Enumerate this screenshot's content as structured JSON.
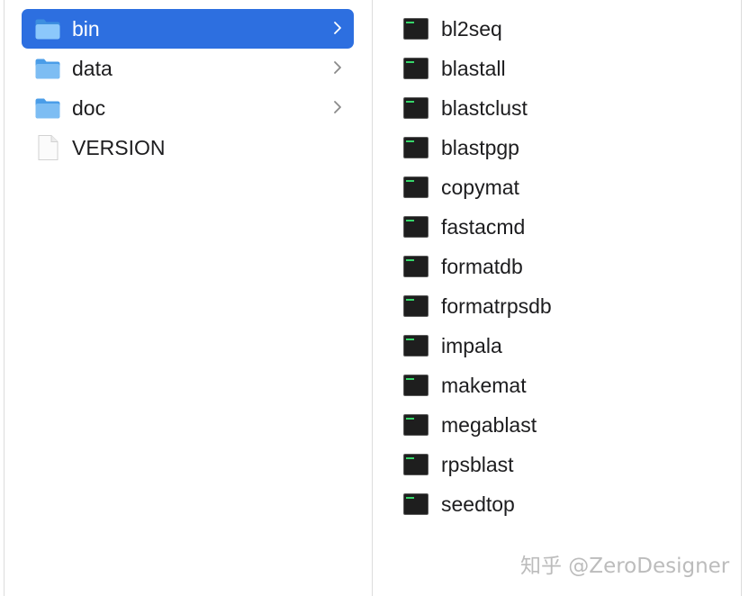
{
  "left_column": {
    "items": [
      {
        "label": "bin",
        "type": "folder",
        "icon": "folder-icon",
        "selected": true
      },
      {
        "label": "data",
        "type": "folder",
        "icon": "folder-icon",
        "selected": false
      },
      {
        "label": "doc",
        "type": "folder",
        "icon": "folder-icon",
        "selected": false
      },
      {
        "label": "VERSION",
        "type": "file",
        "icon": "document-icon",
        "selected": false
      }
    ]
  },
  "right_column": {
    "items": [
      {
        "label": "bl2seq",
        "icon": "terminal-exec-icon"
      },
      {
        "label": "blastall",
        "icon": "terminal-exec-icon"
      },
      {
        "label": "blastclust",
        "icon": "terminal-exec-icon"
      },
      {
        "label": "blastpgp",
        "icon": "terminal-exec-icon"
      },
      {
        "label": "copymat",
        "icon": "terminal-exec-icon"
      },
      {
        "label": "fastacmd",
        "icon": "terminal-exec-icon"
      },
      {
        "label": "formatdb",
        "icon": "terminal-exec-icon"
      },
      {
        "label": "formatrpsdb",
        "icon": "terminal-exec-icon"
      },
      {
        "label": "impala",
        "icon": "terminal-exec-icon"
      },
      {
        "label": "makemat",
        "icon": "terminal-exec-icon"
      },
      {
        "label": "megablast",
        "icon": "terminal-exec-icon"
      },
      {
        "label": "rpsblast",
        "icon": "terminal-exec-icon"
      },
      {
        "label": "seedtop",
        "icon": "terminal-exec-icon"
      }
    ]
  },
  "watermark": {
    "text": "知乎 @ZeroDesigner"
  },
  "colors": {
    "selection": "#2d6fe0",
    "folder": "#5aaef0",
    "exec_icon": "#1e1e1e",
    "exec_text": "#37d66a"
  }
}
